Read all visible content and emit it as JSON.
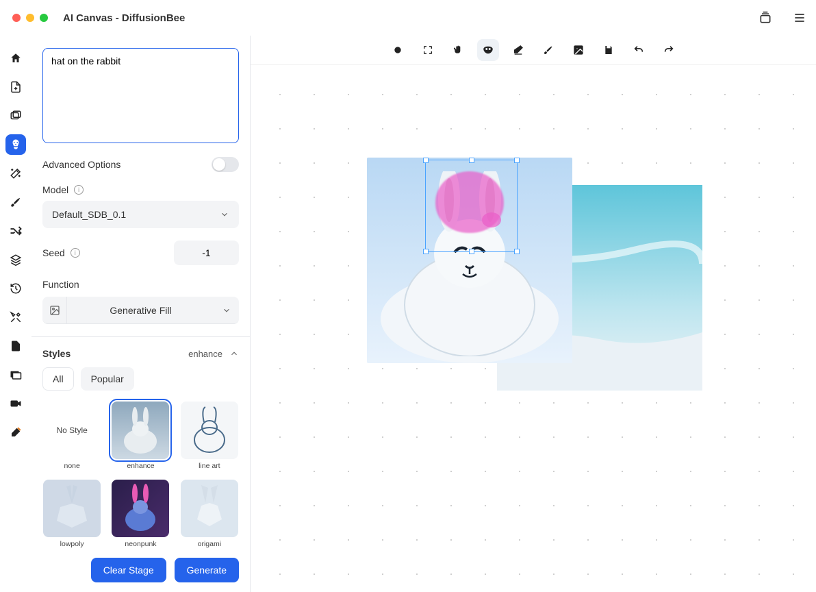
{
  "window": {
    "title": "AI Canvas - DiffusionBee"
  },
  "prompt": {
    "value": "hat on the rabbit"
  },
  "advanced": {
    "label": "Advanced Options",
    "on": false
  },
  "model": {
    "label": "Model",
    "value": "Default_SDB_0.1"
  },
  "seed": {
    "label": "Seed",
    "value": "-1"
  },
  "function": {
    "label": "Function",
    "value": "Generative Fill"
  },
  "styles": {
    "heading": "Styles",
    "current": "enhance",
    "tabs": {
      "all": "All",
      "popular": "Popular"
    },
    "cards": {
      "nostyle": {
        "title": "No Style",
        "caption": "none"
      },
      "enhance": {
        "caption": "enhance"
      },
      "lineart": {
        "caption": "line art"
      },
      "lowpoly": {
        "caption": "lowpoly"
      },
      "neonpunk": {
        "caption": "neonpunk"
      },
      "origami": {
        "caption": "origami"
      }
    }
  },
  "buttons": {
    "clear": "Clear Stage",
    "generate": "Generate"
  }
}
